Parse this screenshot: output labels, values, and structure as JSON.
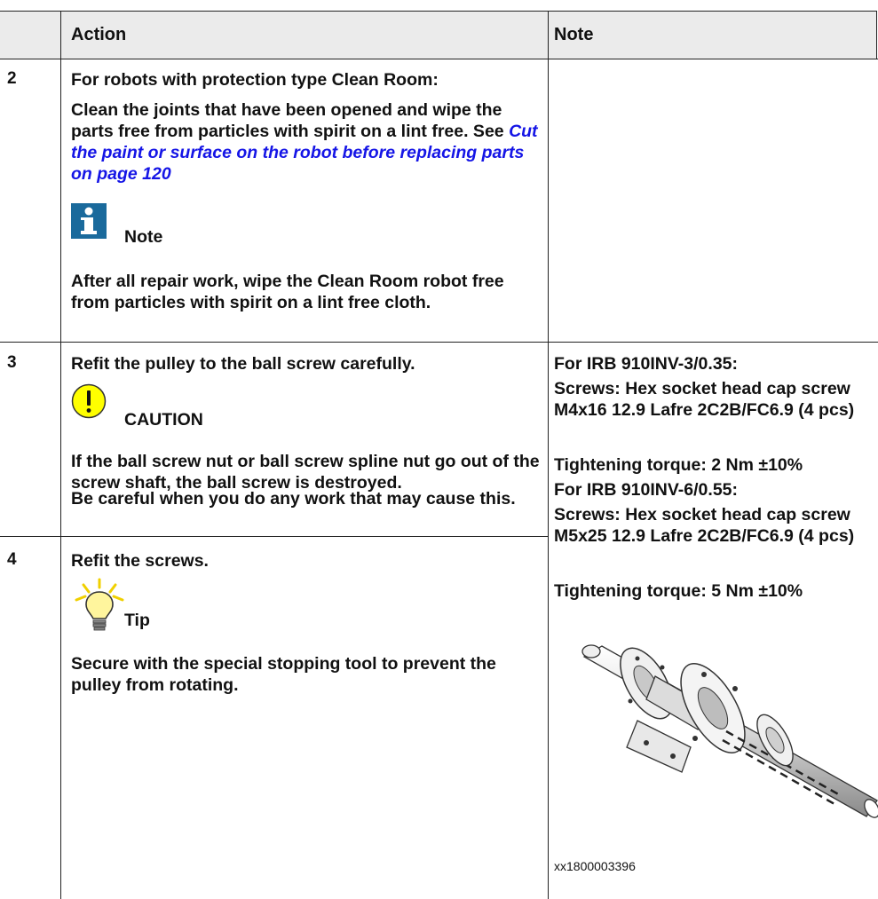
{
  "header": {
    "action": "Action",
    "note": "Note"
  },
  "rows": [
    {
      "step": "2",
      "action_heading": "For robots with protection type Clean Room:",
      "action_body_pre": "Clean the joints that have been opened and wipe the parts free from particles with spirit on a lint free. See ",
      "action_link": "Cut the paint or surface on the robot before replacing parts on page 120",
      "callout_label": "Note",
      "callout_text": "After all repair work, wipe the Clean Room robot free from particles with spirit on a lint free cloth."
    },
    {
      "step": "3",
      "action_text": "Refit the pulley to the ball screw carefully.",
      "callout_label": "CAUTION",
      "callout_text_1": "If the ball screw nut or ball screw spline nut go out of the screw shaft, the ball screw is destroyed.",
      "callout_text_2": "Be careful when you do any work that may cause this."
    },
    {
      "step": "4",
      "action_text": "Refit the screws.",
      "callout_label": "Tip",
      "callout_text": "Secure with the special stopping tool to prevent the pulley from rotating."
    }
  ],
  "note_column": {
    "l1": "For IRB 910INV-3/0.35:",
    "l2": "Screws: Hex socket head cap screw M4x16 12.9 Lafre 2C2B/FC6.9 (4 pcs)",
    "l3": "Tightening torque: 2 Nm ±10%",
    "l4": "For IRB 910INV-6/0.55:",
    "l5": "Screws: Hex socket head cap screw M5x25 12.9 Lafre 2C2B/FC6.9 (4 pcs)",
    "l6": "Tightening torque: 5 Nm ±10%",
    "figure_caption": "xx1800003396"
  },
  "colors": {
    "header_bg": "#ebebeb",
    "link": "#1515e6",
    "note_icon": "#1a6a9c",
    "caution_icon": "#ffff00"
  },
  "icons": [
    "info-icon",
    "caution-icon",
    "tip-bulb-icon"
  ]
}
